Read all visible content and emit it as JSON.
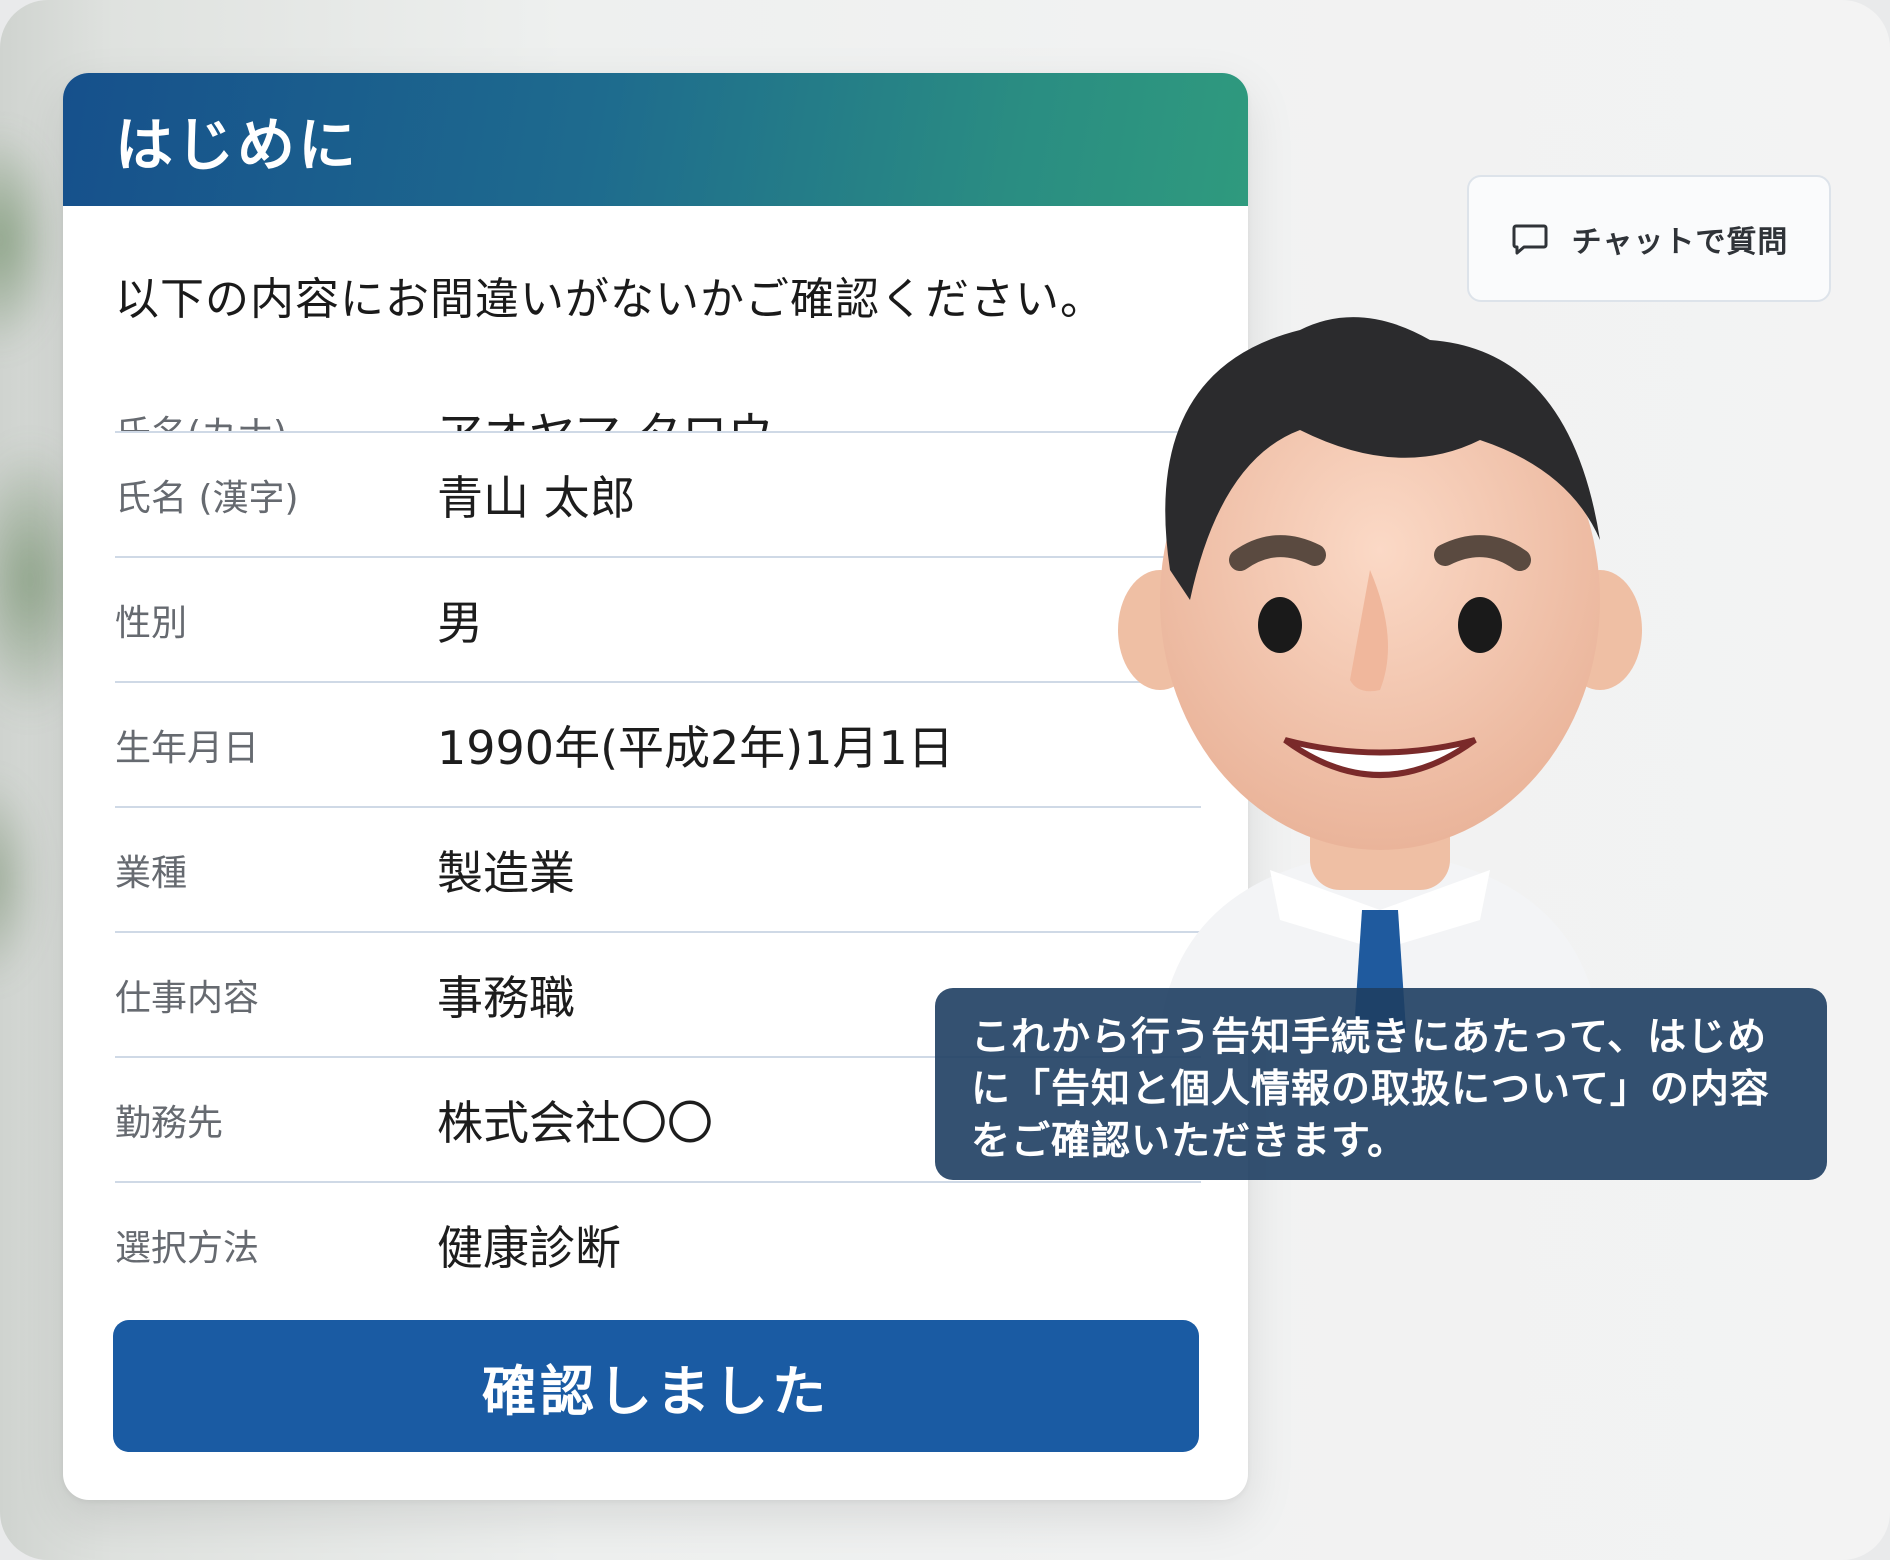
{
  "header": {
    "title": "はじめに"
  },
  "intro": "以下の内容にお間違いがないかご確認ください。",
  "partial_row": {
    "label": "氏名(カナ)",
    "value": "アオヤマ タロウ"
  },
  "rows": [
    {
      "label": "氏名 (漢字)",
      "value": "青山 太郎"
    },
    {
      "label": "性別",
      "value": "男"
    },
    {
      "label": "生年月日",
      "value": "1990年(平成2年)1月1日"
    },
    {
      "label": "業種",
      "value": "製造業"
    },
    {
      "label": "仕事内容",
      "value": "事務職"
    },
    {
      "label": "勤務先",
      "value": "株式会社〇〇"
    },
    {
      "label": "選択方法",
      "value": "健康診断"
    }
  ],
  "confirm_button": "確認しました",
  "chat_button": {
    "label": "チャットで質問",
    "icon": "chat-bubble-icon"
  },
  "bubble_text": "これから行う告知手続きにあたって、はじめに「告知と個人情報の取扱について」の内容をご確認いただきます。",
  "colors": {
    "header_start": "#16508c",
    "header_end": "#2f9a7e",
    "button": "#1a5ba3",
    "bubble": "#1e3e62"
  }
}
